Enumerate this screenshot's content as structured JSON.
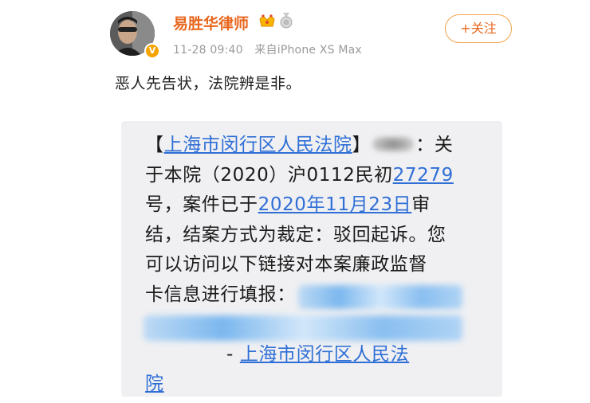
{
  "post": {
    "author_name": "易胜华律师",
    "time": "11-28 09:40",
    "source": "来自iPhone XS Max",
    "follow_label": "+关注",
    "text": "恶人先告状，法院辨是非。"
  },
  "sms": {
    "court_name": "上海市闵行区人民法院",
    "intro_tail": "：关",
    "line2_a": "于本院（2020）沪0112民初",
    "case_number": "27279",
    "line3_a": "号，案件已于",
    "date": "2020年11月23日",
    "line3_b": "审",
    "line4": "结，结案方式为裁定：驳回起诉。您",
    "line5": "可以访问以下链接对本案廉政监督",
    "line6": "卡信息进行填报：",
    "signature_dash": "- ",
    "signature_a": "上海市闵行区人民法",
    "signature_b": "院"
  },
  "colors": {
    "author": "#e8671e",
    "link": "#2f6fd6",
    "meta": "#9a9a9a",
    "sms_bg": "#f0f0f2"
  },
  "icons": [
    "avatar",
    "verified-badge-icon",
    "crown-icon",
    "medal-icon"
  ]
}
